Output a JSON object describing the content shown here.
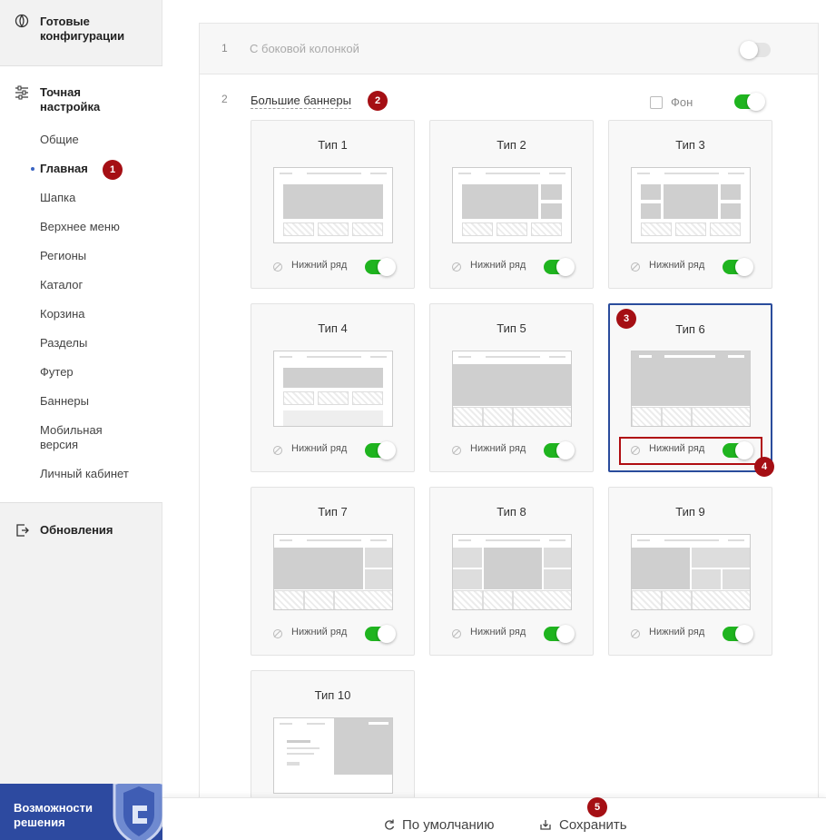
{
  "sidebar": {
    "sections": {
      "ready": "Готовые конфигурации",
      "fine": "Точная настройка",
      "updates": "Обновления"
    },
    "items": [
      {
        "label": "Общие"
      },
      {
        "label": "Главная",
        "active": true
      },
      {
        "label": "Шапка"
      },
      {
        "label": "Верхнее меню"
      },
      {
        "label": "Регионы"
      },
      {
        "label": "Каталог"
      },
      {
        "label": "Корзина"
      },
      {
        "label": "Разделы"
      },
      {
        "label": "Футер"
      },
      {
        "label": "Баннеры"
      },
      {
        "label": "Мобильная версия"
      },
      {
        "label": "Личный кабинет"
      }
    ],
    "promo": "Возможности решения"
  },
  "badges": {
    "b1": "1",
    "b2": "2",
    "b3": "3",
    "b4": "4",
    "b5": "5"
  },
  "rows": {
    "row1": {
      "num": "1",
      "label": "С боковой колонкой",
      "enabled": false
    },
    "row2": {
      "num": "2",
      "label": "Большие баннеры",
      "bg_label": "Фон",
      "bg_checked": false,
      "enabled": true
    }
  },
  "cards": [
    {
      "title": "Тип 1",
      "bottom_label": "Нижний ряд",
      "bottom_on": true
    },
    {
      "title": "Тип 2",
      "bottom_label": "Нижний ряд",
      "bottom_on": true
    },
    {
      "title": "Тип 3",
      "bottom_label": "Нижний ряд",
      "bottom_on": true
    },
    {
      "title": "Тип 4",
      "bottom_label": "Нижний ряд",
      "bottom_on": true
    },
    {
      "title": "Тип 5",
      "bottom_label": "Нижний ряд",
      "bottom_on": true
    },
    {
      "title": "Тип 6",
      "bottom_label": "Нижний ряд",
      "bottom_on": true,
      "selected": true
    },
    {
      "title": "Тип 7",
      "bottom_label": "Нижний ряд",
      "bottom_on": true
    },
    {
      "title": "Тип 8",
      "bottom_label": "Нижний ряд",
      "bottom_on": true
    },
    {
      "title": "Тип 9",
      "bottom_label": "Нижний ряд",
      "bottom_on": true
    },
    {
      "title": "Тип 10"
    }
  ],
  "footer": {
    "reset": "По умолчанию",
    "save": "Сохранить"
  },
  "colors": {
    "accent": "#2a4c9c",
    "toggle_on": "#1fb41f",
    "badge": "#a50f14"
  }
}
